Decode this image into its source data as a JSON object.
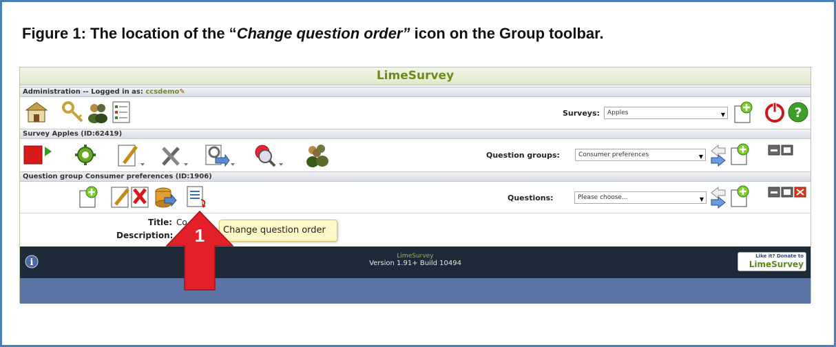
{
  "caption": {
    "prefix": "Figure 1:  The location of the “",
    "emphasis": "Change question order”",
    "suffix": " icon on the Group toolbar."
  },
  "app": {
    "title": "LimeSurvey",
    "admin_bar": {
      "text": "Administration -- Logged in as: ",
      "user": "ccsdemo"
    },
    "surveys": {
      "label": "Surveys:",
      "selected": "Apples"
    },
    "survey_bar": {
      "text": "Survey Apples (ID:62419)"
    },
    "question_groups": {
      "label": "Question groups:",
      "selected": "Consumer preferences"
    },
    "group_bar": {
      "text": "Question group Consumer preferences (ID:1906)"
    },
    "questions": {
      "label": "Questions:",
      "selected": "Please choose..."
    },
    "info": {
      "title_label": "Title:",
      "title_value": "Co",
      "description_label": "Description:"
    },
    "tooltip": "Change question order",
    "callout_number": "1",
    "footer": {
      "name": "LimeSurvey",
      "version": "Version 1.91+ Build 10494",
      "donate_small": "Like it? Donate to",
      "donate_big": "LimeSurvey"
    }
  },
  "colors": {
    "frame_border": "#4a7fb5",
    "brand_green": "#6d8a1a",
    "footer_bg": "#1d2a38",
    "tooltip_bg": "#fff8c9",
    "callout_red": "#e2202a",
    "blue_bar": "#5b74a4"
  }
}
